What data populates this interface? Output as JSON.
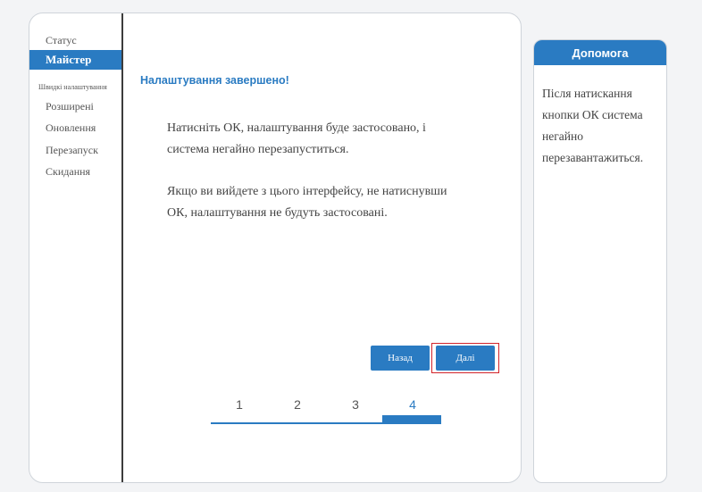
{
  "sidebar": {
    "items": [
      {
        "label": "Статус"
      },
      {
        "label": "Майстер"
      },
      {
        "label": "Швидкі налаштування"
      },
      {
        "label": "Розширені"
      },
      {
        "label": "Оновлення"
      },
      {
        "label": "Перезапуск"
      },
      {
        "label": "Скидання"
      }
    ]
  },
  "main": {
    "title": "Налаштування завершено!",
    "paragraph1_line1": "Натисніть ОК, налаштування буде застосовано, і",
    "paragraph1_line2": "система негайно перезапуститься.",
    "paragraph2_line1": "Якщо ви вийдете з цього інтерфейсу, не натиснувши",
    "paragraph2_line2": "ОК, налаштування не будуть застосовані.",
    "back_label": "Назад",
    "next_label": "Далі"
  },
  "steps": {
    "items": [
      "1",
      "2",
      "3",
      "4"
    ],
    "current": 4,
    "progress": 1.0
  },
  "help": {
    "title": "Допомога",
    "text": "Після натискання кнопки ОК система негайно перезавантажиться."
  },
  "colors": {
    "accent": "#2a7bc2",
    "highlight": "#d2232a"
  }
}
